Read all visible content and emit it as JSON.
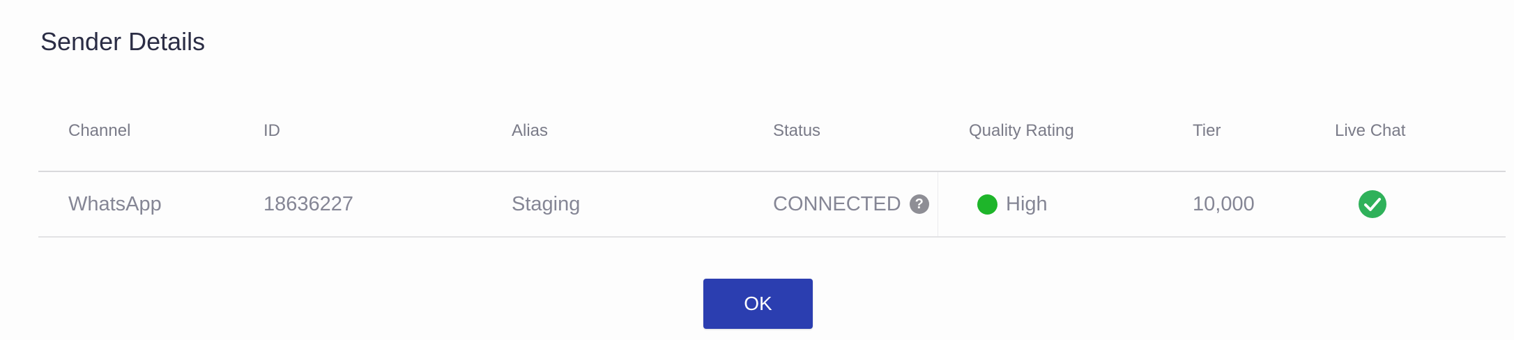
{
  "dialog": {
    "title": "Sender Details",
    "ok_label": "OK"
  },
  "table": {
    "headers": {
      "channel": "Channel",
      "id": "ID",
      "alias": "Alias",
      "status": "Status",
      "quality": "Quality Rating",
      "tier": "Tier",
      "live_chat": "Live Chat"
    },
    "rows": [
      {
        "channel": "WhatsApp",
        "id": "18636227",
        "alias": "Staging",
        "status": "CONNECTED",
        "status_help_icon": "question-circle-icon",
        "quality": "High",
        "quality_color": "#1eb52a",
        "tier": "10,000",
        "live_chat_icon": "check-circle-icon",
        "live_chat_color": "#2fb15a"
      }
    ]
  },
  "colors": {
    "primary_button": "#2b3eb0",
    "title_text": "#2b2d45"
  }
}
